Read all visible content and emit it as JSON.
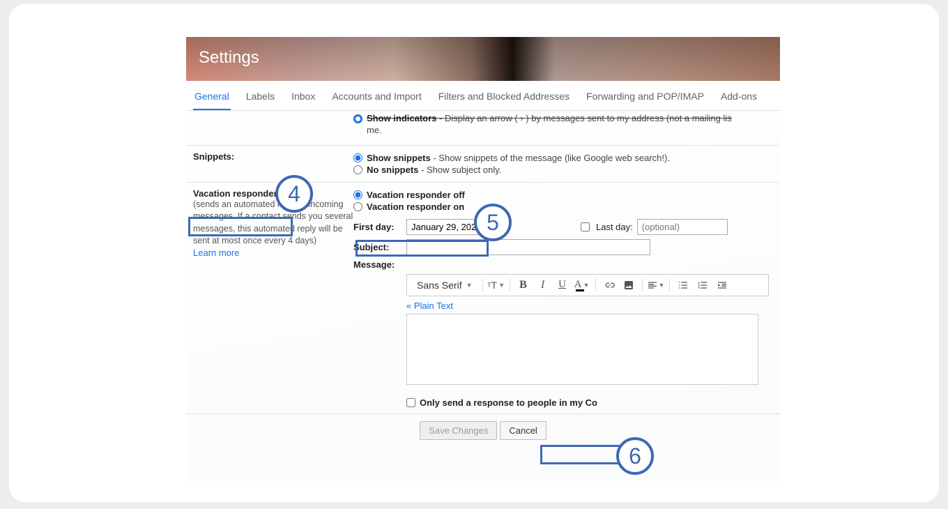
{
  "header": {
    "title": "Settings"
  },
  "tabs": [
    "General",
    "Labels",
    "Inbox",
    "Accounts and Import",
    "Filters and Blocked Addresses",
    "Forwarding and POP/IMAP",
    "Add-ons"
  ],
  "active_tab": 0,
  "indicators": {
    "cutoff_bold": "Show indicators",
    "cutoff_desc1": " - Display an arrow ( › ) by messages sent to my address (not a mailing lis",
    "cutoff_desc2": "me."
  },
  "snippets": {
    "label": "Snippets:",
    "opt1_bold": "Show snippets",
    "opt1_desc": " - Show snippets of the message (like Google web search!).",
    "opt2_bold": "No snippets",
    "opt2_desc": " - Show subject only.",
    "selected": 0
  },
  "vacation": {
    "label": "Vacation responder:",
    "sub": "(sends an automated reply to incoming messages. If a contact sends you several messages, this automated reply will be sent at most once every 4 days)",
    "learn_more": "Learn more",
    "off": "Vacation responder off",
    "on": "Vacation responder on",
    "selected": "off",
    "first_day_label": "First day:",
    "first_day_value": "January 29, 2022",
    "last_day_label": "Last day:",
    "last_day_placeholder": "(optional)",
    "subject_label": "Subject:",
    "subject_value": "",
    "message_label": "Message:",
    "font_name": "Sans Serif",
    "plain_text": "« Plain Text",
    "contacts_label_1": "Only send a response to people in my Co",
    "contacts_checked": false
  },
  "footer": {
    "save": "Save Changes",
    "cancel": "Cancel"
  },
  "badges": {
    "b4": "4",
    "b5": "5",
    "b6": "6"
  }
}
